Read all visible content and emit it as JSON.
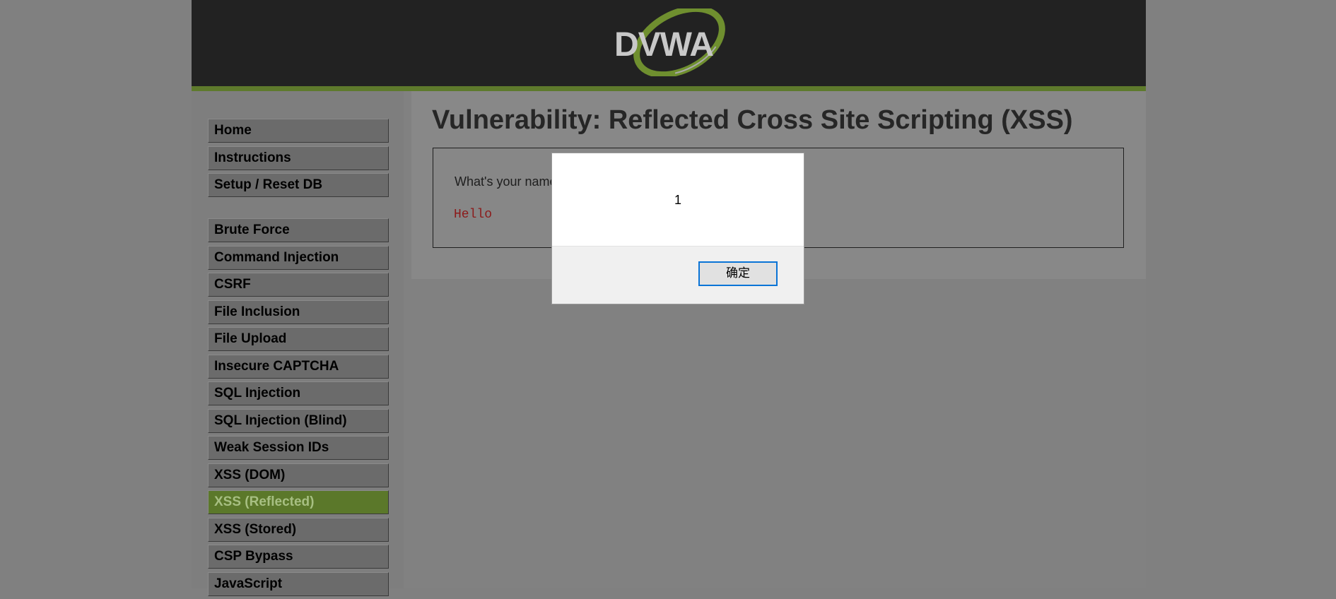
{
  "header": {
    "logo_text": "DVWA"
  },
  "colors": {
    "background": "#808080",
    "header": "#222222",
    "accent": "#5e7a2c",
    "selected_text": "#a7bf82",
    "hello_text": "#8c1a1a",
    "dialog_button_border": "#0a74d6"
  },
  "menu": {
    "group1": [
      {
        "label": "Home"
      },
      {
        "label": "Instructions"
      },
      {
        "label": "Setup / Reset DB"
      }
    ],
    "group2": [
      {
        "label": "Brute Force"
      },
      {
        "label": "Command Injection"
      },
      {
        "label": "CSRF"
      },
      {
        "label": "File Inclusion"
      },
      {
        "label": "File Upload"
      },
      {
        "label": "Insecure CAPTCHA"
      },
      {
        "label": "SQL Injection"
      },
      {
        "label": "SQL Injection (Blind)"
      },
      {
        "label": "Weak Session IDs"
      },
      {
        "label": "XSS (DOM)"
      },
      {
        "label": "XSS (Reflected)",
        "selected": true
      },
      {
        "label": "XSS (Stored)"
      },
      {
        "label": "CSP Bypass"
      },
      {
        "label": "JavaScript"
      }
    ]
  },
  "main": {
    "title": "Vulnerability: Reflected Cross Site Scripting (XSS)",
    "question": "What's your name?",
    "output": "Hello"
  },
  "dialog": {
    "message": "1",
    "ok_label": "确定"
  }
}
